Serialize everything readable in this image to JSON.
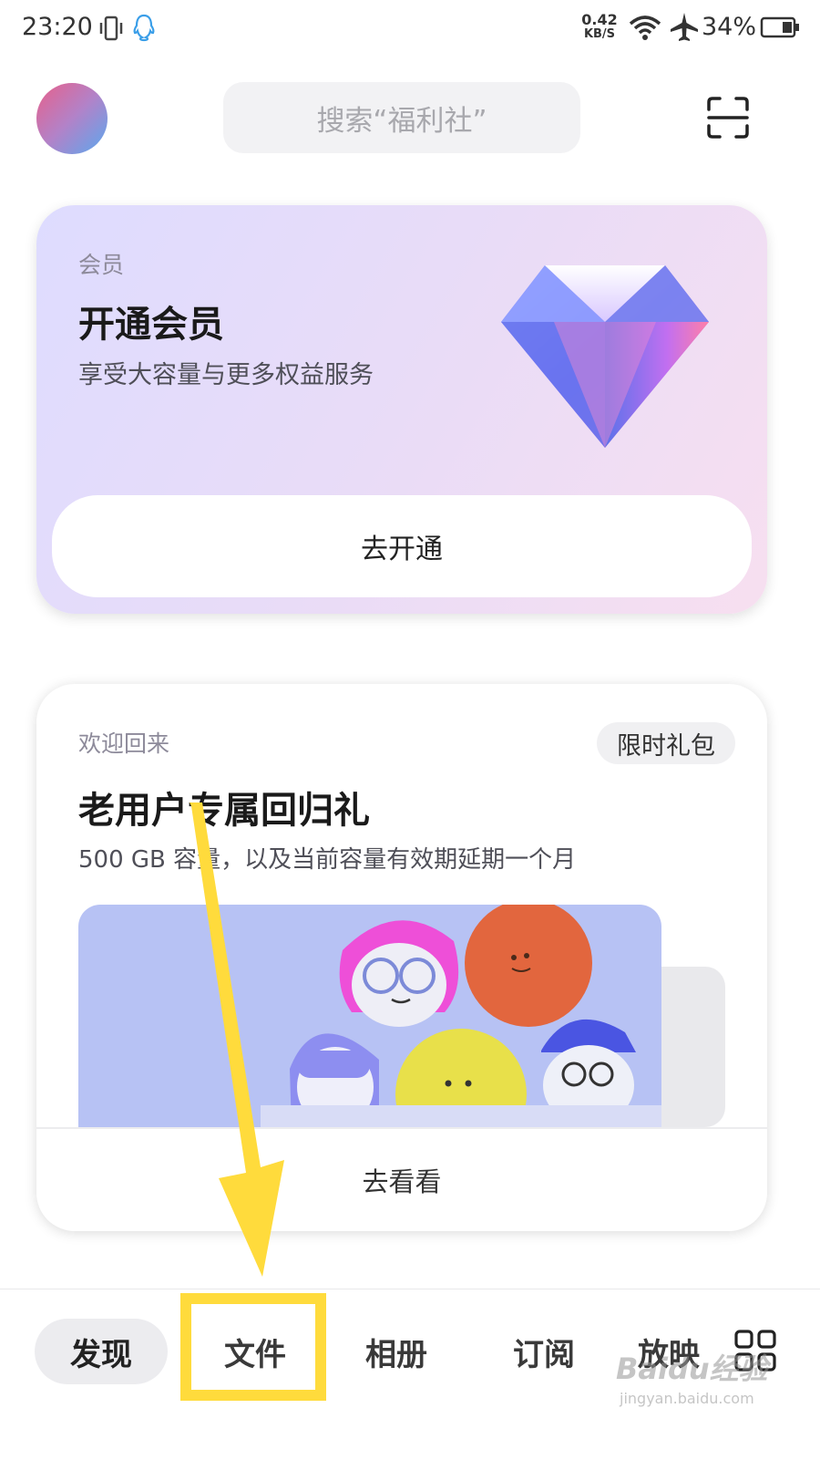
{
  "status_bar": {
    "time": "23:20",
    "net_speed_value": "0.42",
    "net_speed_unit": "KB/S",
    "battery_percent": "34%"
  },
  "header": {
    "search_placeholder": "搜索“福利社”"
  },
  "vip_card": {
    "tag": "会员",
    "title": "开通会员",
    "description": "享受大容量与更多权益服务",
    "button_label": "去开通"
  },
  "welcome_card": {
    "tag": "欢迎回来",
    "badge": "限时礼包",
    "title": "老用户专属回归礼",
    "description": "500 GB 容量，以及当前容量有效期延期一个月",
    "button_label": "去看看"
  },
  "bottom_nav": {
    "tabs": [
      {
        "label": "发现",
        "active": true
      },
      {
        "label": "文件",
        "active": false
      },
      {
        "label": "相册",
        "active": false
      },
      {
        "label": "订阅",
        "active": false
      },
      {
        "label": "放映",
        "active": false
      }
    ]
  },
  "watermark": {
    "logo": "Baidu经验",
    "url": "jingyan.baidu.com"
  },
  "colors": {
    "highlight": "#ffdb3c",
    "active_tab_bg": "#ececef"
  },
  "icons": [
    "vibrate-icon",
    "qq-icon",
    "wifi-icon",
    "airplane-icon",
    "battery-icon",
    "scan-icon",
    "diamond-icon",
    "grid-icon"
  ]
}
